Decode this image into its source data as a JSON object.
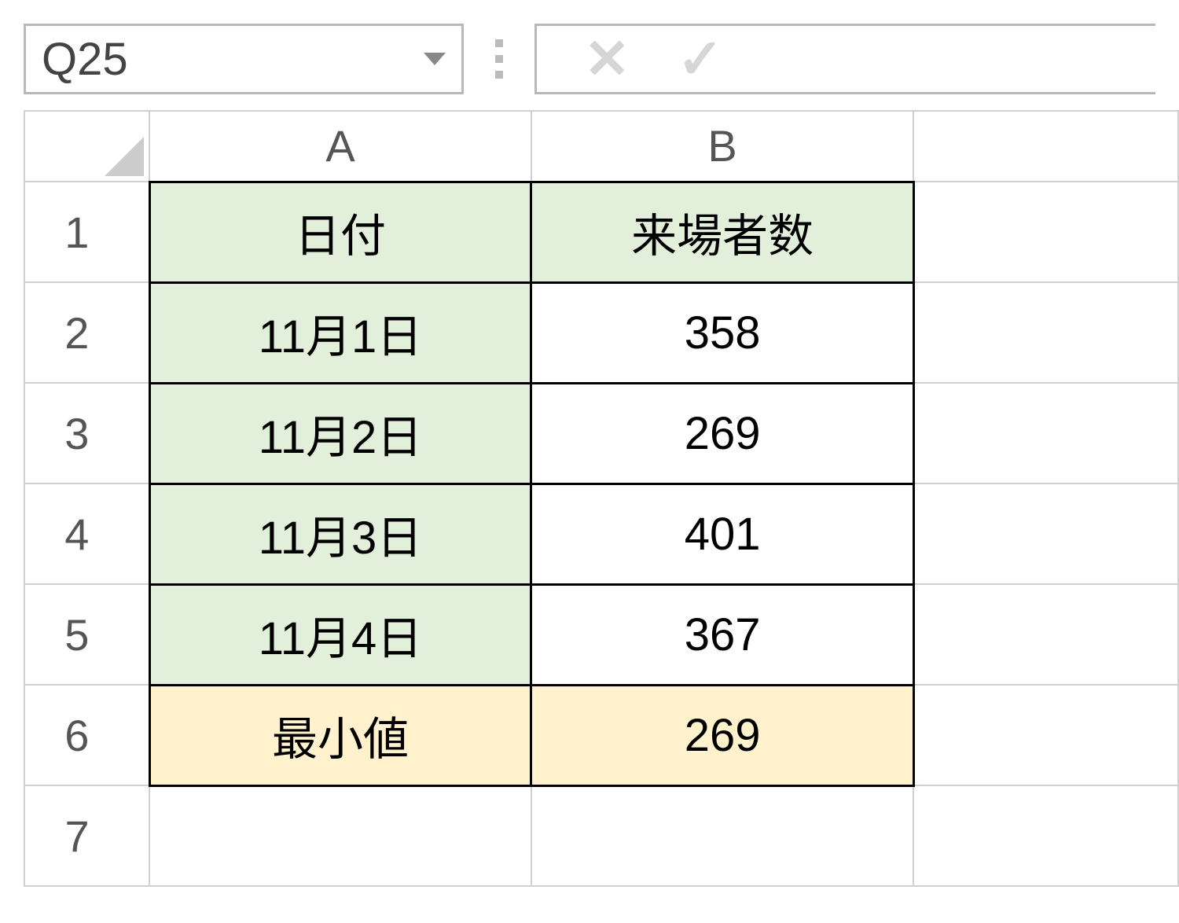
{
  "name_box": {
    "value": "Q25"
  },
  "column_headers": [
    "A",
    "B"
  ],
  "row_headers": [
    "1",
    "2",
    "3",
    "4",
    "5",
    "6",
    "7"
  ],
  "cells": {
    "A1": "日付",
    "B1": "来場者数",
    "A2": "11月1日",
    "B2": "358",
    "A3": "11月2日",
    "B3": "269",
    "A4": "11月3日",
    "B4": "401",
    "A5": "11月4日",
    "B5": "367",
    "A6": "最小値",
    "B6": "269"
  },
  "chart_data": {
    "type": "table",
    "title": "来場者数",
    "categories": [
      "11月1日",
      "11月2日",
      "11月3日",
      "11月4日"
    ],
    "values": [
      358,
      269,
      401,
      367
    ],
    "summary": {
      "label": "最小値",
      "value": 269
    }
  }
}
